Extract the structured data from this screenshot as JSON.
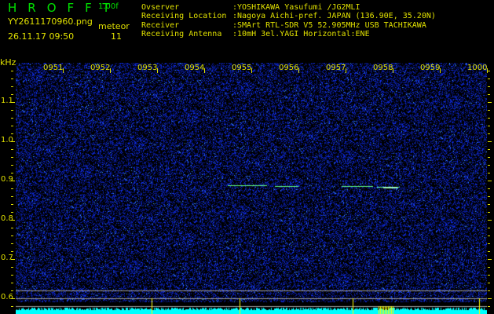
{
  "header": {
    "logo": "HROFFT",
    "version": "1.00f",
    "filename": "YY2611170960.png",
    "datetime": "26.11.17 09:50",
    "meteor_label": "meteor",
    "meteor_count": "11"
  },
  "info": [
    {
      "label": "Ovserver",
      "value": ":YOSHIKAWA Yasufumi /JG2MLI"
    },
    {
      "label": "Receiving Location",
      "value": ":Nagoya Aichi-pref. JAPAN (136.90E, 35.20N)"
    },
    {
      "label": "Receiver",
      "value": ":SMArt RTL-SDR V5 52.905MHz USB TACHIKAWA"
    },
    {
      "label": "Receiving Antenna",
      "value": ":10mH 3el.YAGI Horizontal:ENE"
    }
  ],
  "axis": {
    "unit": "kHz",
    "x_labels": [
      "0951",
      "0952",
      "0953",
      "0954",
      "0955",
      "0956",
      "0957",
      "0958",
      "0959",
      "1000"
    ],
    "y_labels": [
      "1.1",
      "1.0",
      "0.9",
      "0.8",
      "0.7",
      "0.6"
    ]
  },
  "colors": {
    "text": "#e0e000",
    "logo": "#00e000",
    "noise": "#0a1ee6",
    "level": "#00ffff",
    "marker": "#ffff00"
  }
}
